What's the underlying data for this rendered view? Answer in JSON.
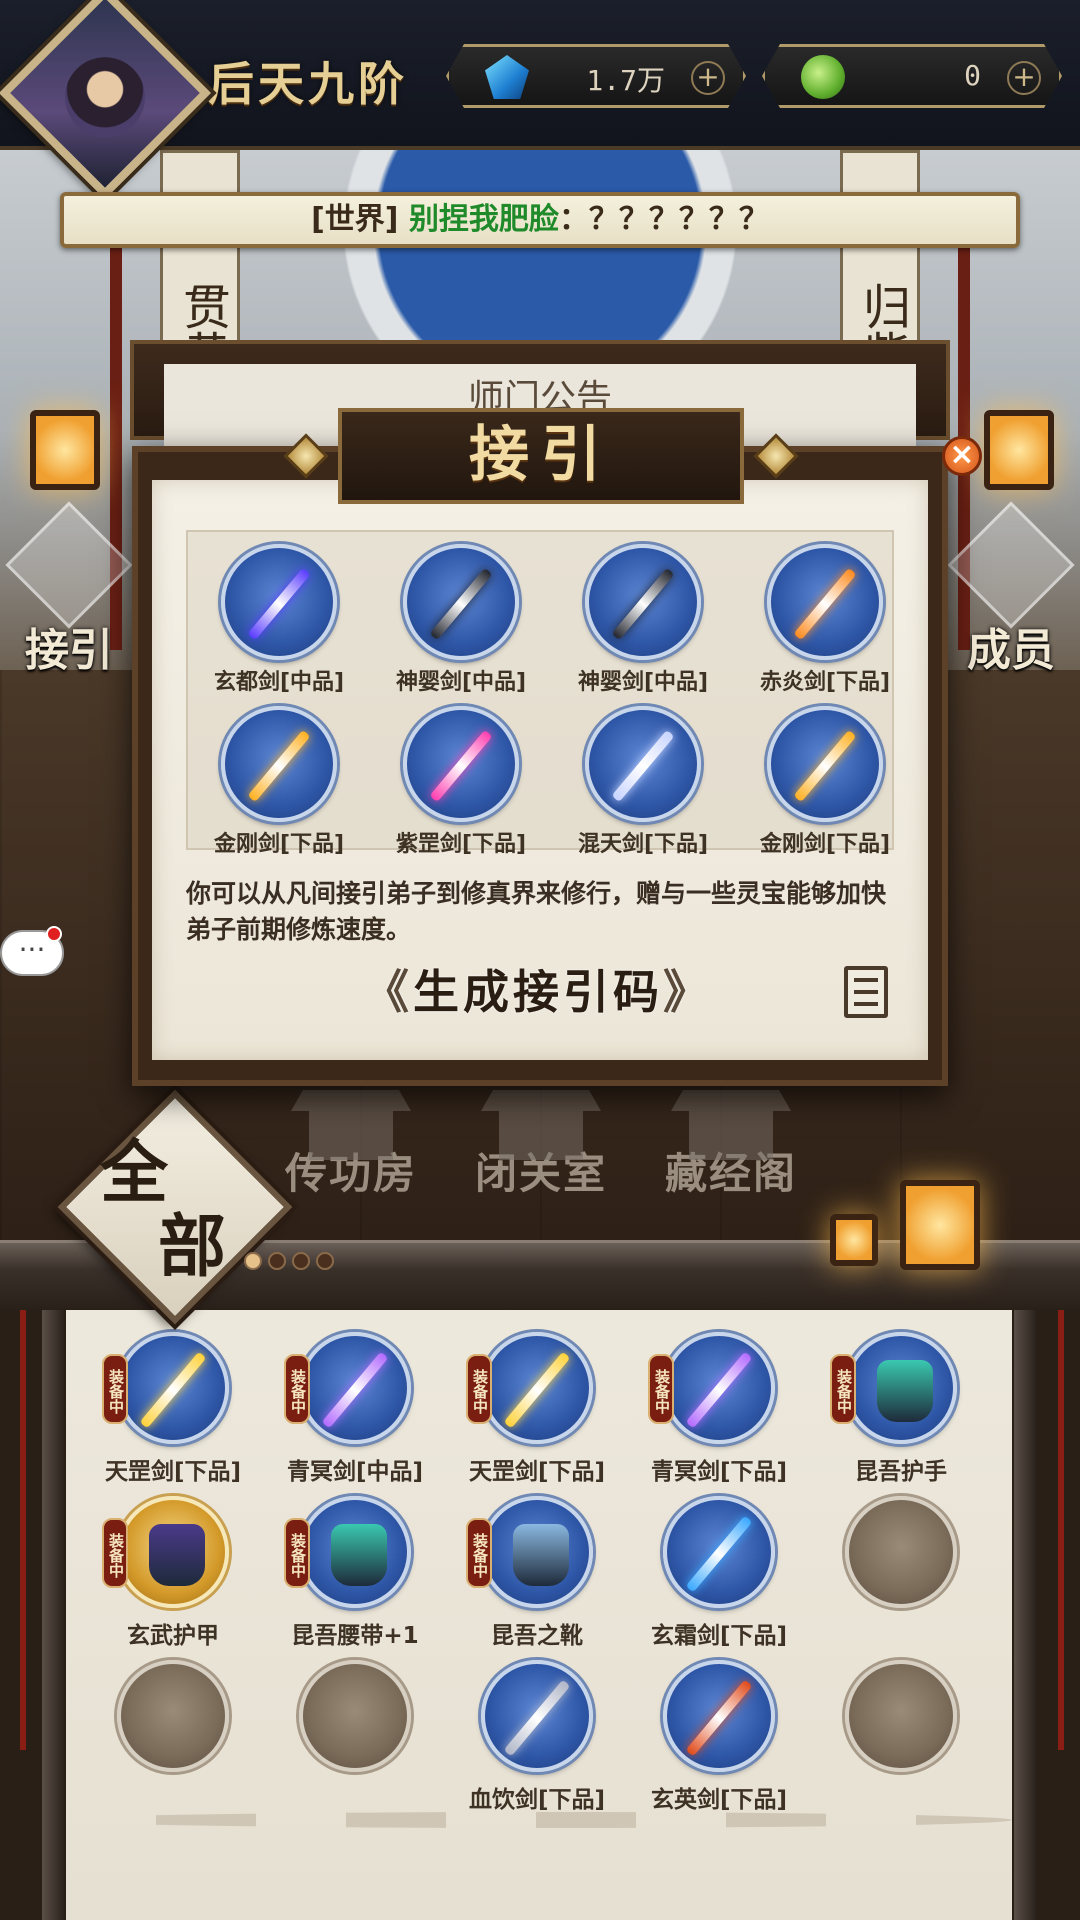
{
  "player": {
    "name": "后天九阶"
  },
  "currencies": [
    {
      "icon": "spirit-stone-icon",
      "value": "1.7万"
    },
    {
      "icon": "jade-icon",
      "value": "0"
    }
  ],
  "world_chat": {
    "channel": "[世界]",
    "sender": "别捏我肥脸",
    "message": "：？？？？？？"
  },
  "hall": {
    "notice_board": "师门公告",
    "left_banner": "贯黄",
    "right_banner": "归紫"
  },
  "side_buttons": {
    "left": "接引",
    "right": "成员"
  },
  "modal": {
    "title": "接引",
    "close_label": "×",
    "rewards": [
      {
        "name": "玄都剑[中品]",
        "color": "#5a3cff"
      },
      {
        "name": "神婴剑[中品]",
        "color": "#22252e"
      },
      {
        "name": "神婴剑[中品]",
        "color": "#22252e"
      },
      {
        "name": "赤炎剑[下品]",
        "color": "#ff8a1e"
      },
      {
        "name": "金刚剑[下品]",
        "color": "#ffb020"
      },
      {
        "name": "紫罡剑[下品]",
        "color": "#ff3fb0"
      },
      {
        "name": "混天剑[下品]",
        "color": "#c8d4ff"
      },
      {
        "name": "金刚剑[下品]",
        "color": "#ffb020"
      }
    ],
    "description": "你可以从凡间接引弟子到修真界来修行，赠与一些灵宝能够加快弟子前期修炼速度。",
    "generate_button": "生成接引码",
    "arrow_left": "《",
    "arrow_right": "》"
  },
  "chat_bubble": "···",
  "tabs": {
    "all": [
      "全",
      "部"
    ],
    "rooms": [
      "传功房",
      "闭关室",
      "藏经阁"
    ]
  },
  "inventory": {
    "equip_tag": "装备中",
    "items": [
      {
        "name": "天罡剑[下品]",
        "equipped": true,
        "kind": "blade",
        "color": "#ffd23a"
      },
      {
        "name": "青冥剑[中品]",
        "equipped": true,
        "kind": "blade",
        "color": "#b36bff"
      },
      {
        "name": "天罡剑[下品]",
        "equipped": true,
        "kind": "blade",
        "color": "#ffd23a"
      },
      {
        "name": "青冥剑[下品]",
        "equipped": true,
        "kind": "blade",
        "color": "#b36bff"
      },
      {
        "name": "昆吾护手",
        "equipped": true,
        "kind": "armor",
        "color": "#3ac8b0"
      },
      {
        "name": "玄武护甲",
        "equipped": true,
        "kind": "armor-gold",
        "color": "#4a3a8a"
      },
      {
        "name": "昆吾腰带+1",
        "equipped": true,
        "kind": "armor",
        "color": "#3ac8b0"
      },
      {
        "name": "昆吾之靴",
        "equipped": true,
        "kind": "armor",
        "color": "#8ab8e0"
      },
      {
        "name": "玄霜剑[下品]",
        "equipped": false,
        "kind": "blade",
        "color": "#3aa8ff"
      },
      {
        "name": "",
        "equipped": false,
        "kind": "empty",
        "color": ""
      },
      {
        "name": "",
        "equipped": false,
        "kind": "empty",
        "color": ""
      },
      {
        "name": "",
        "equipped": false,
        "kind": "empty",
        "color": ""
      },
      {
        "name": "血饮剑[下品]",
        "equipped": false,
        "kind": "blade",
        "color": "#b0b6c8"
      },
      {
        "name": "玄英剑[下品]",
        "equipped": false,
        "kind": "blade",
        "color": "#e04a1a"
      },
      {
        "name": "",
        "equipped": false,
        "kind": "empty",
        "color": ""
      }
    ]
  }
}
